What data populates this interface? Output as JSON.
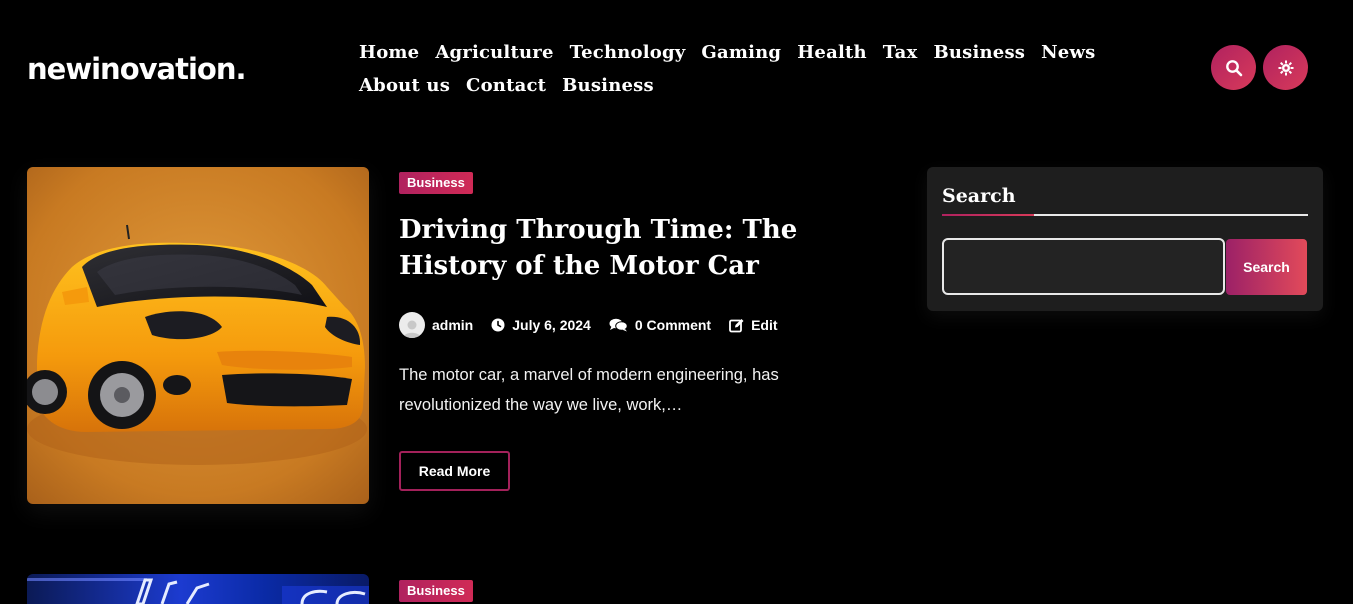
{
  "site": {
    "logo": "newinovation."
  },
  "nav": {
    "row1": [
      "Home",
      "Agriculture",
      "Technology",
      "Gaming",
      "Health",
      "Tax",
      "Business",
      "News"
    ],
    "row2": [
      "About us",
      "Contact",
      "Business"
    ]
  },
  "header_buttons": {
    "search_icon": "search-icon",
    "theme_icon": "gear-icon"
  },
  "posts": [
    {
      "category": "Business",
      "title": "Driving Through Time: The History of the Motor Car",
      "author": "admin",
      "date": "July 6, 2024",
      "comments": "0 Comment",
      "edit": "Edit",
      "excerpt": "The motor car, a marvel of modern engineering, has revolutionized the way we live, work,…",
      "read_more": "Read More"
    },
    {
      "category": "Business"
    }
  ],
  "sidebar": {
    "search_title": "Search",
    "search_placeholder": "",
    "search_button": "Search"
  },
  "colors": {
    "accent_start": "#b0225f",
    "accent_end": "#d83a5a",
    "background": "#000000",
    "widget_bg": "#1e1e1e"
  }
}
